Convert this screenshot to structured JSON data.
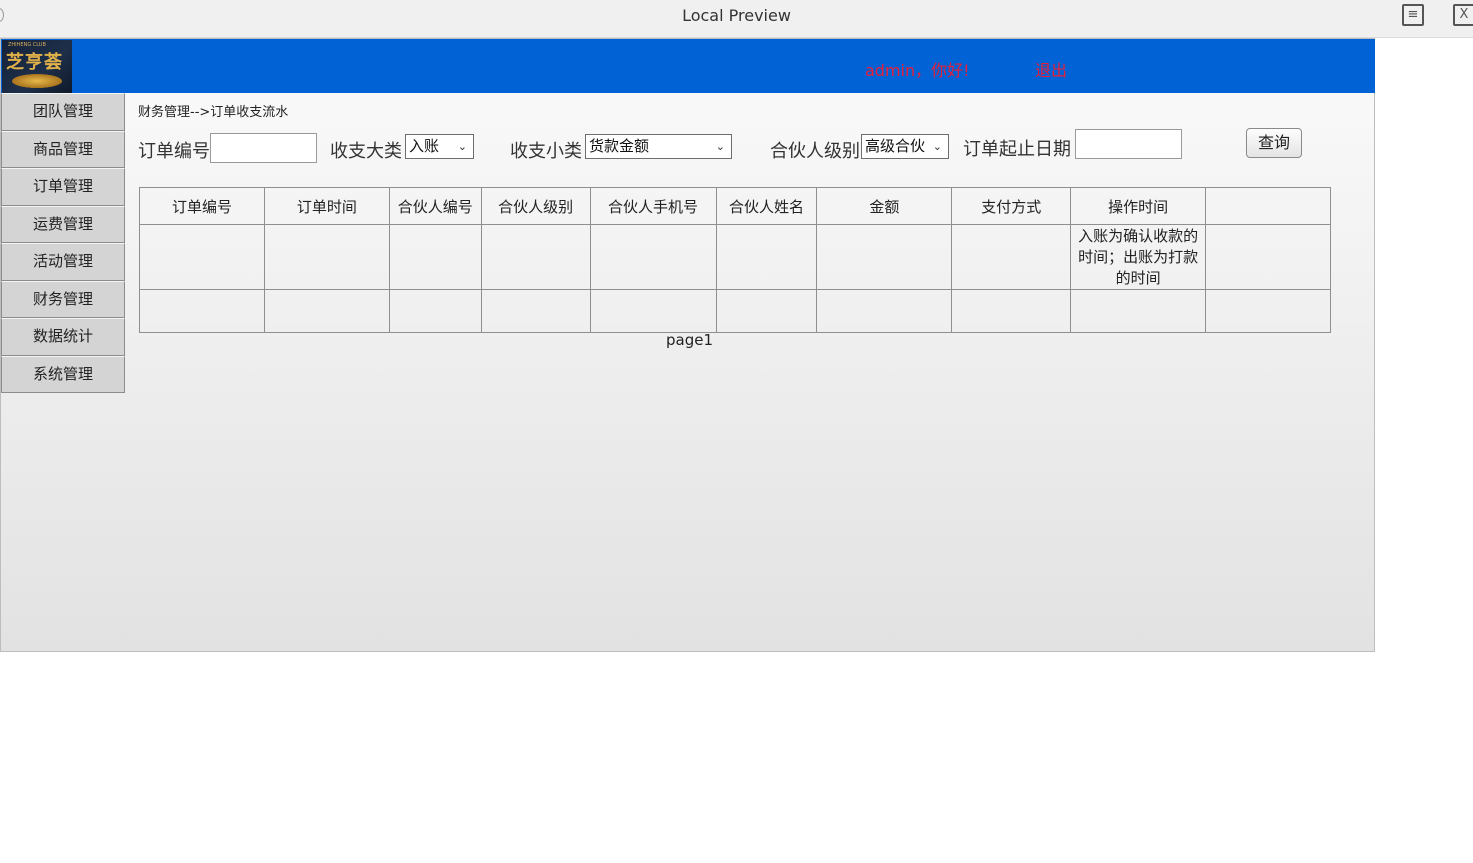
{
  "window": {
    "title": "Local Preview"
  },
  "header": {
    "logo_text": "芝亨荟",
    "logo_sub": "ZHIHENG CLUB",
    "greeting": "admin，你好!",
    "logout": "退出"
  },
  "sidebar": {
    "items": [
      {
        "label": "团队管理"
      },
      {
        "label": "商品管理"
      },
      {
        "label": "订单管理"
      },
      {
        "label": "运费管理"
      },
      {
        "label": "活动管理"
      },
      {
        "label": "财务管理"
      },
      {
        "label": "数据统计"
      },
      {
        "label": "系统管理"
      }
    ]
  },
  "breadcrumb": "财务管理-->订单收支流水",
  "filters": {
    "order_no_label": "订单编号",
    "order_no_value": "",
    "category_label": "收支大类",
    "category_value": "入账",
    "subcategory_label": "收支小类",
    "subcategory_value": "货款金额",
    "partner_level_label": "合伙人级别",
    "partner_level_value": "高级合伙",
    "date_label": "订单起止日期",
    "date_value": "",
    "query_button": "查询"
  },
  "table": {
    "columns": [
      "订单编号",
      "订单时间",
      "合伙人编号",
      "合伙人级别",
      "合伙人手机号",
      "合伙人姓名",
      "金额",
      "支付方式",
      "操作时间",
      ""
    ],
    "row1_note": "入账为确认收款的时间；出账为打款的时间"
  },
  "pager": "page1"
}
